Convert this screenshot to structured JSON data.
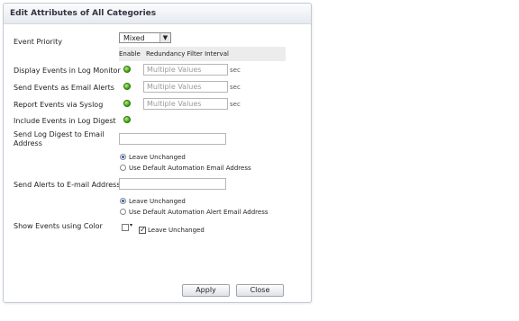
{
  "dialog": {
    "title": "Edit Attributes of All Categories",
    "event_priority": {
      "label": "Event Priority",
      "value": "Mixed"
    },
    "headers": {
      "enable": "Enable",
      "interval": "Redundancy Filter Interval"
    },
    "rows": [
      {
        "label": "Display Events in Log Monitor",
        "interval_placeholder": "Multiple Values",
        "unit": "sec"
      },
      {
        "label": "Send Events as Email Alerts",
        "interval_placeholder": "Multiple Values",
        "unit": "sec"
      },
      {
        "label": "Report Events via Syslog",
        "interval_placeholder": "Multiple Values",
        "unit": "sec"
      },
      {
        "label": "Include Events in Log Digest"
      }
    ],
    "log_digest_email": {
      "label_line1": "Send Log Digest to Email",
      "label_line2": "Address",
      "value": "",
      "options": [
        "Leave Unchanged",
        "Use Default Automation Email Address"
      ],
      "selected": "Leave Unchanged"
    },
    "alerts_email": {
      "label": "Send Alerts to E-mail Address",
      "value": "",
      "options": [
        "Leave Unchanged",
        "Use Default Automation Alert Email Address"
      ],
      "selected": "Leave Unchanged"
    },
    "color": {
      "label": "Show Events using Color",
      "checkbox_label": "Leave Unchanged",
      "checked": true
    },
    "buttons": {
      "apply": "Apply",
      "close": "Close"
    }
  },
  "colors": {
    "enabled_indicator": "#3d9a10",
    "radio_selected": "#1a5fbf",
    "title_text": "#334"
  }
}
